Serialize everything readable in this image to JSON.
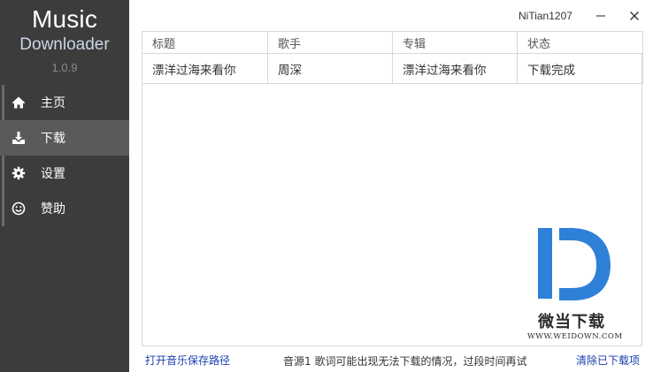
{
  "sidebar": {
    "title": "Music",
    "subtitle": "Downloader",
    "version": "1.0.9",
    "items": [
      {
        "label": "主页",
        "icon": "home-icon",
        "active": false
      },
      {
        "label": "下载",
        "icon": "download-icon",
        "active": true
      },
      {
        "label": "设置",
        "icon": "gear-icon",
        "active": false
      },
      {
        "label": "赞助",
        "icon": "smile-icon",
        "active": false
      }
    ]
  },
  "titlebar": {
    "username": "NiTian1207",
    "minimize_label": "—",
    "close_label": "✕"
  },
  "table": {
    "columns": [
      "标题",
      "歌手",
      "专辑",
      "状态"
    ],
    "rows": [
      [
        "漂洋过海来看你",
        "周深",
        "漂洋过海来看你",
        "下载完成"
      ]
    ]
  },
  "watermark": {
    "brand": "微当下载",
    "url": "WWW.WEIDOWN.COM",
    "color": "#2f80d8"
  },
  "footer": {
    "open_path_link": "打开音乐保存路径",
    "status_text": "音源1 歌词可能出现无法下载的情况，过段时间再试",
    "clear_link": "清除已下载项"
  },
  "colors": {
    "sidebar_bg": "#3c3c3c",
    "sidebar_active": "#5a5a5a",
    "link": "#1a3fb0"
  }
}
